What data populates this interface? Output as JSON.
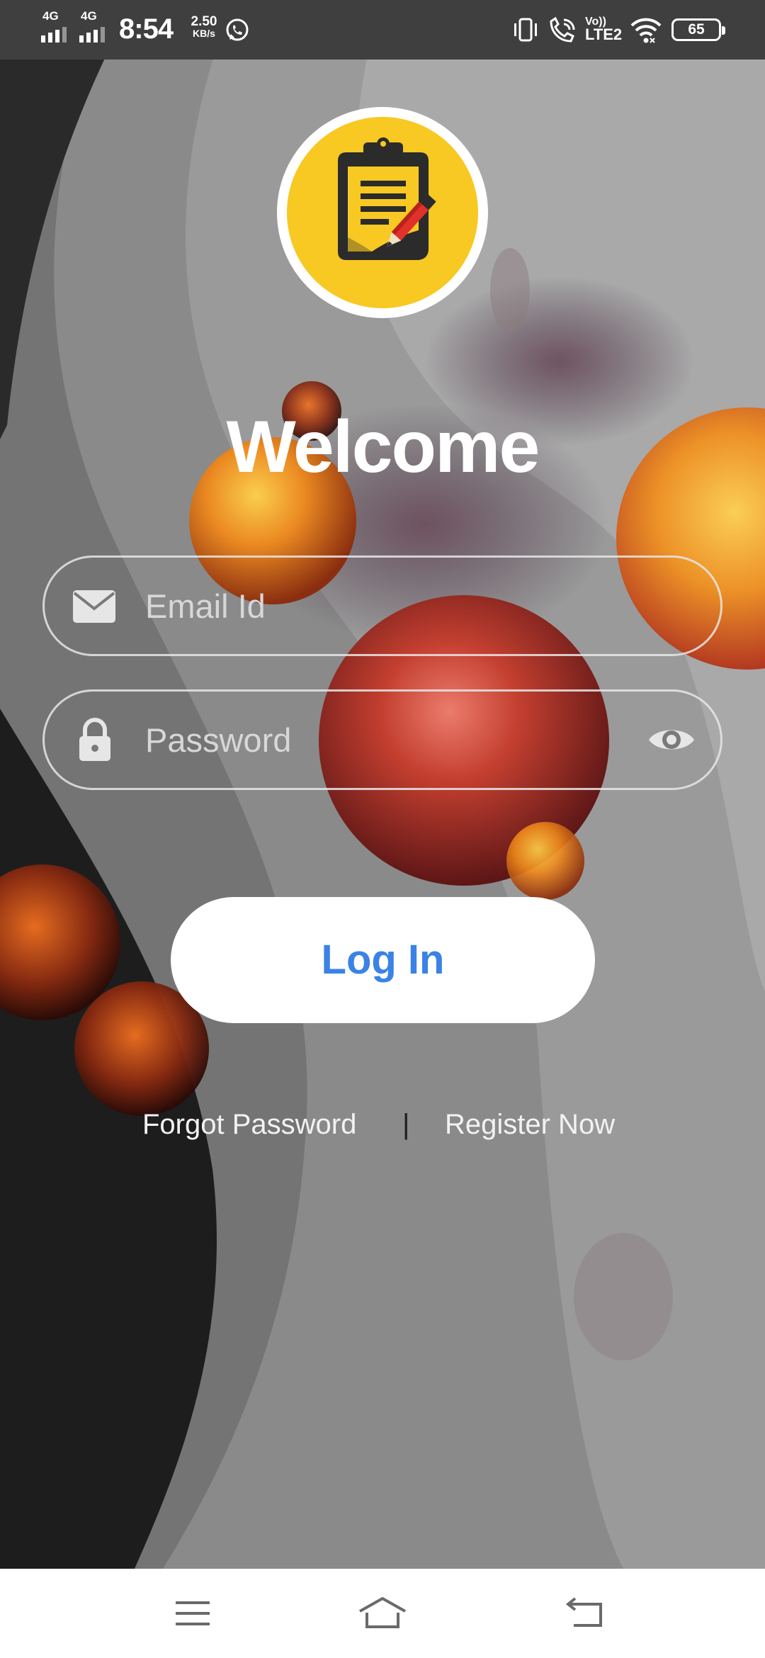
{
  "status_bar": {
    "network_1": "4G",
    "network_2": "4G",
    "time": "8:54",
    "speed_value": "2.50",
    "speed_unit": "KB/s",
    "volte_top": "Vo))",
    "volte_bottom": "LTE2",
    "battery": "65",
    "icons": [
      "signal-icon",
      "whatsapp-icon",
      "vibrate-icon",
      "wifi-calling-icon",
      "wifi-icon",
      "battery-icon"
    ]
  },
  "logo": {
    "icon": "clipboard-pencil-icon"
  },
  "welcome": "Welcome",
  "form": {
    "email": {
      "placeholder": "Email Id",
      "value": "",
      "icon": "mail-icon"
    },
    "password": {
      "placeholder": "Password",
      "value": "",
      "icon": "lock-icon",
      "toggle_icon": "eye-icon"
    },
    "login_label": "Log In"
  },
  "links": {
    "forgot": "Forgot Password",
    "separator": "|",
    "register": "Register Now"
  },
  "nav_bar": {
    "icons": [
      "menu-icon",
      "home-icon",
      "back-icon"
    ]
  },
  "colors": {
    "accent_blue": "#3b82e6",
    "logo_yellow": "#f8c823",
    "status_bar": "#3f3f3f"
  }
}
